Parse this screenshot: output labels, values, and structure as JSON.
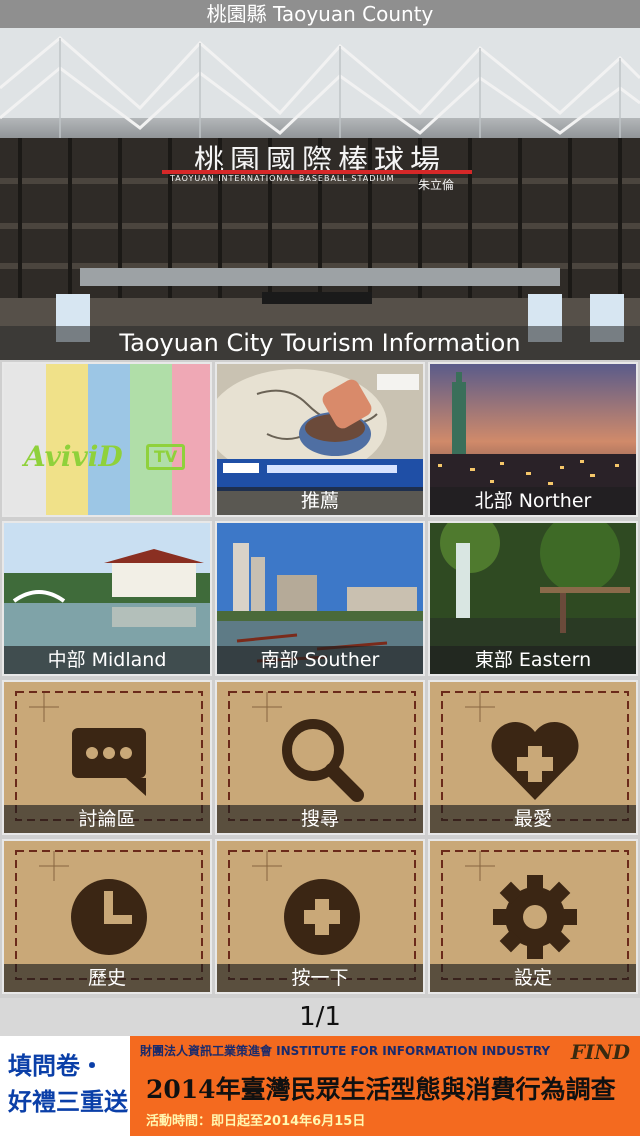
{
  "header": {
    "title": "桃園縣 Taoyuan County"
  },
  "hero": {
    "caption": "Taoyuan City Tourism Information",
    "sign_text": "桃園國際棒球場",
    "sign_subtext": "TAOYUAN INTERNATIONAL BASEBALL STADIUM",
    "sign_author": "朱立倫"
  },
  "tiles": [
    {
      "id": "aviivid",
      "label": "",
      "logo": "AviviD",
      "badge": "TV"
    },
    {
      "id": "recommend",
      "label": "推薦"
    },
    {
      "id": "north",
      "label": "北部 Norther"
    },
    {
      "id": "midland",
      "label": "中部 Midland"
    },
    {
      "id": "south",
      "label": "南部 Souther"
    },
    {
      "id": "east",
      "label": "東部 Eastern"
    },
    {
      "id": "forum",
      "label": "討論區",
      "icon": "chat-bubble-icon"
    },
    {
      "id": "search",
      "label": "搜尋",
      "icon": "search-icon"
    },
    {
      "id": "favorite",
      "label": "最愛",
      "icon": "heart-plus-icon"
    },
    {
      "id": "history",
      "label": "歷史",
      "icon": "clock-icon"
    },
    {
      "id": "press",
      "label": "按一下",
      "icon": "plus-circle-icon"
    },
    {
      "id": "settings",
      "label": "設定",
      "icon": "gear-icon"
    }
  ],
  "pager": {
    "text": "1/1"
  },
  "ad": {
    "left_line1": "填問卷・",
    "left_line2": "好禮三重送",
    "org": "財團法人資訊工業策進會 INSTITUTE FOR INFORMATION INDUSTRY",
    "title": "2014年臺灣民眾生活型態與消費行為調查",
    "date": "活動時間：即日起至2014年6月15日",
    "brand": "FIND"
  },
  "colors": {
    "header_bg": "#8f8f8f",
    "map_parchment": "#c9a878",
    "icon_brown": "#3b2614",
    "ad_orange": "#f46a1f"
  }
}
